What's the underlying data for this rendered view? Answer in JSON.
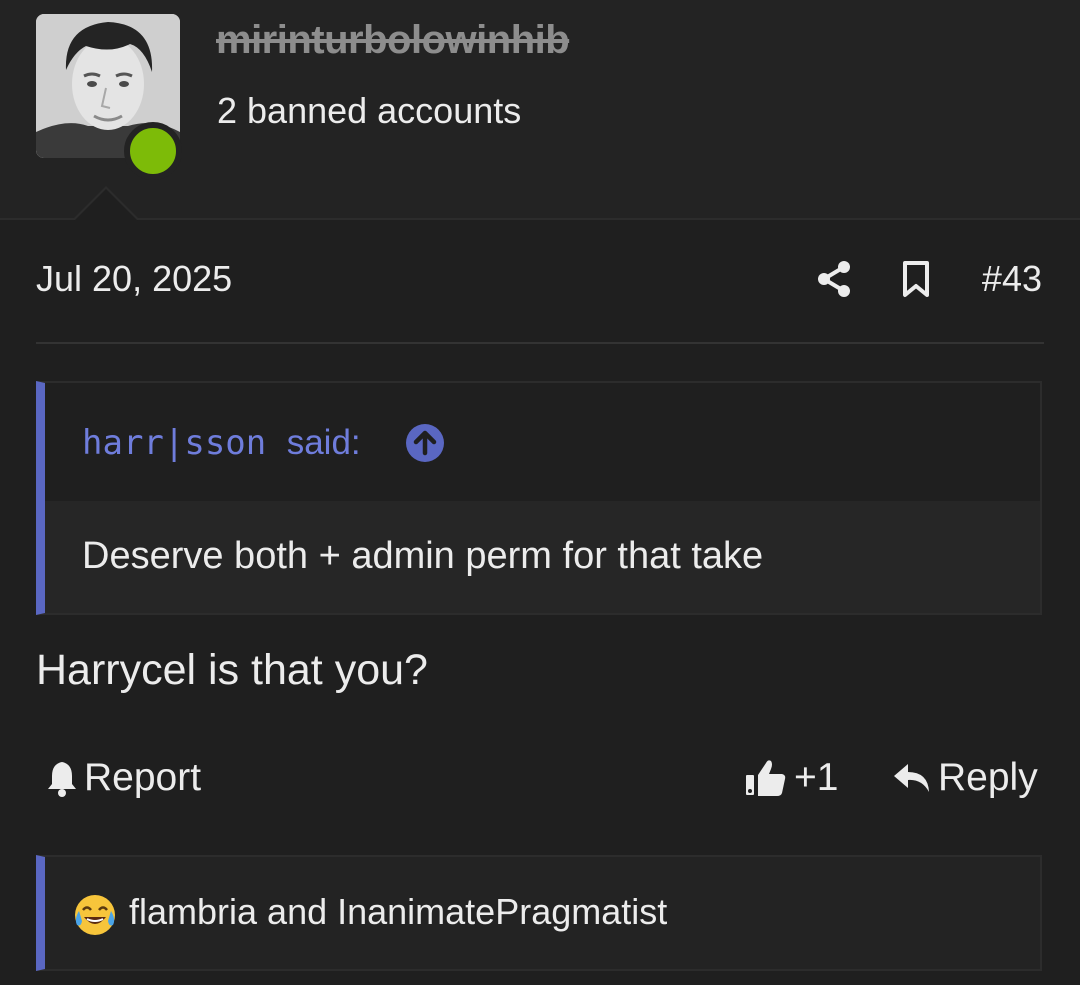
{
  "user": {
    "username": "mirinturbolowinhib",
    "title": "2 banned accounts",
    "status_color": "#7dbb08",
    "avatar_icon": "user-avatar-photo"
  },
  "post": {
    "date": "Jul 20, 2025",
    "number": "#43",
    "share_icon": "share-icon",
    "bookmark_icon": "bookmark-icon",
    "body": "Harrycel is that you?"
  },
  "quote": {
    "author": "harr|sson",
    "said_label": "said:",
    "text": "Deserve both + admin perm for that take",
    "accent_color": "#5a67c2"
  },
  "actions": {
    "report_label": "Report",
    "like_count": "+1",
    "reply_label": "Reply"
  },
  "reactions": {
    "emoji": "tears-of-joy-emoji",
    "text": "flambria and InanimatePragmatist"
  }
}
